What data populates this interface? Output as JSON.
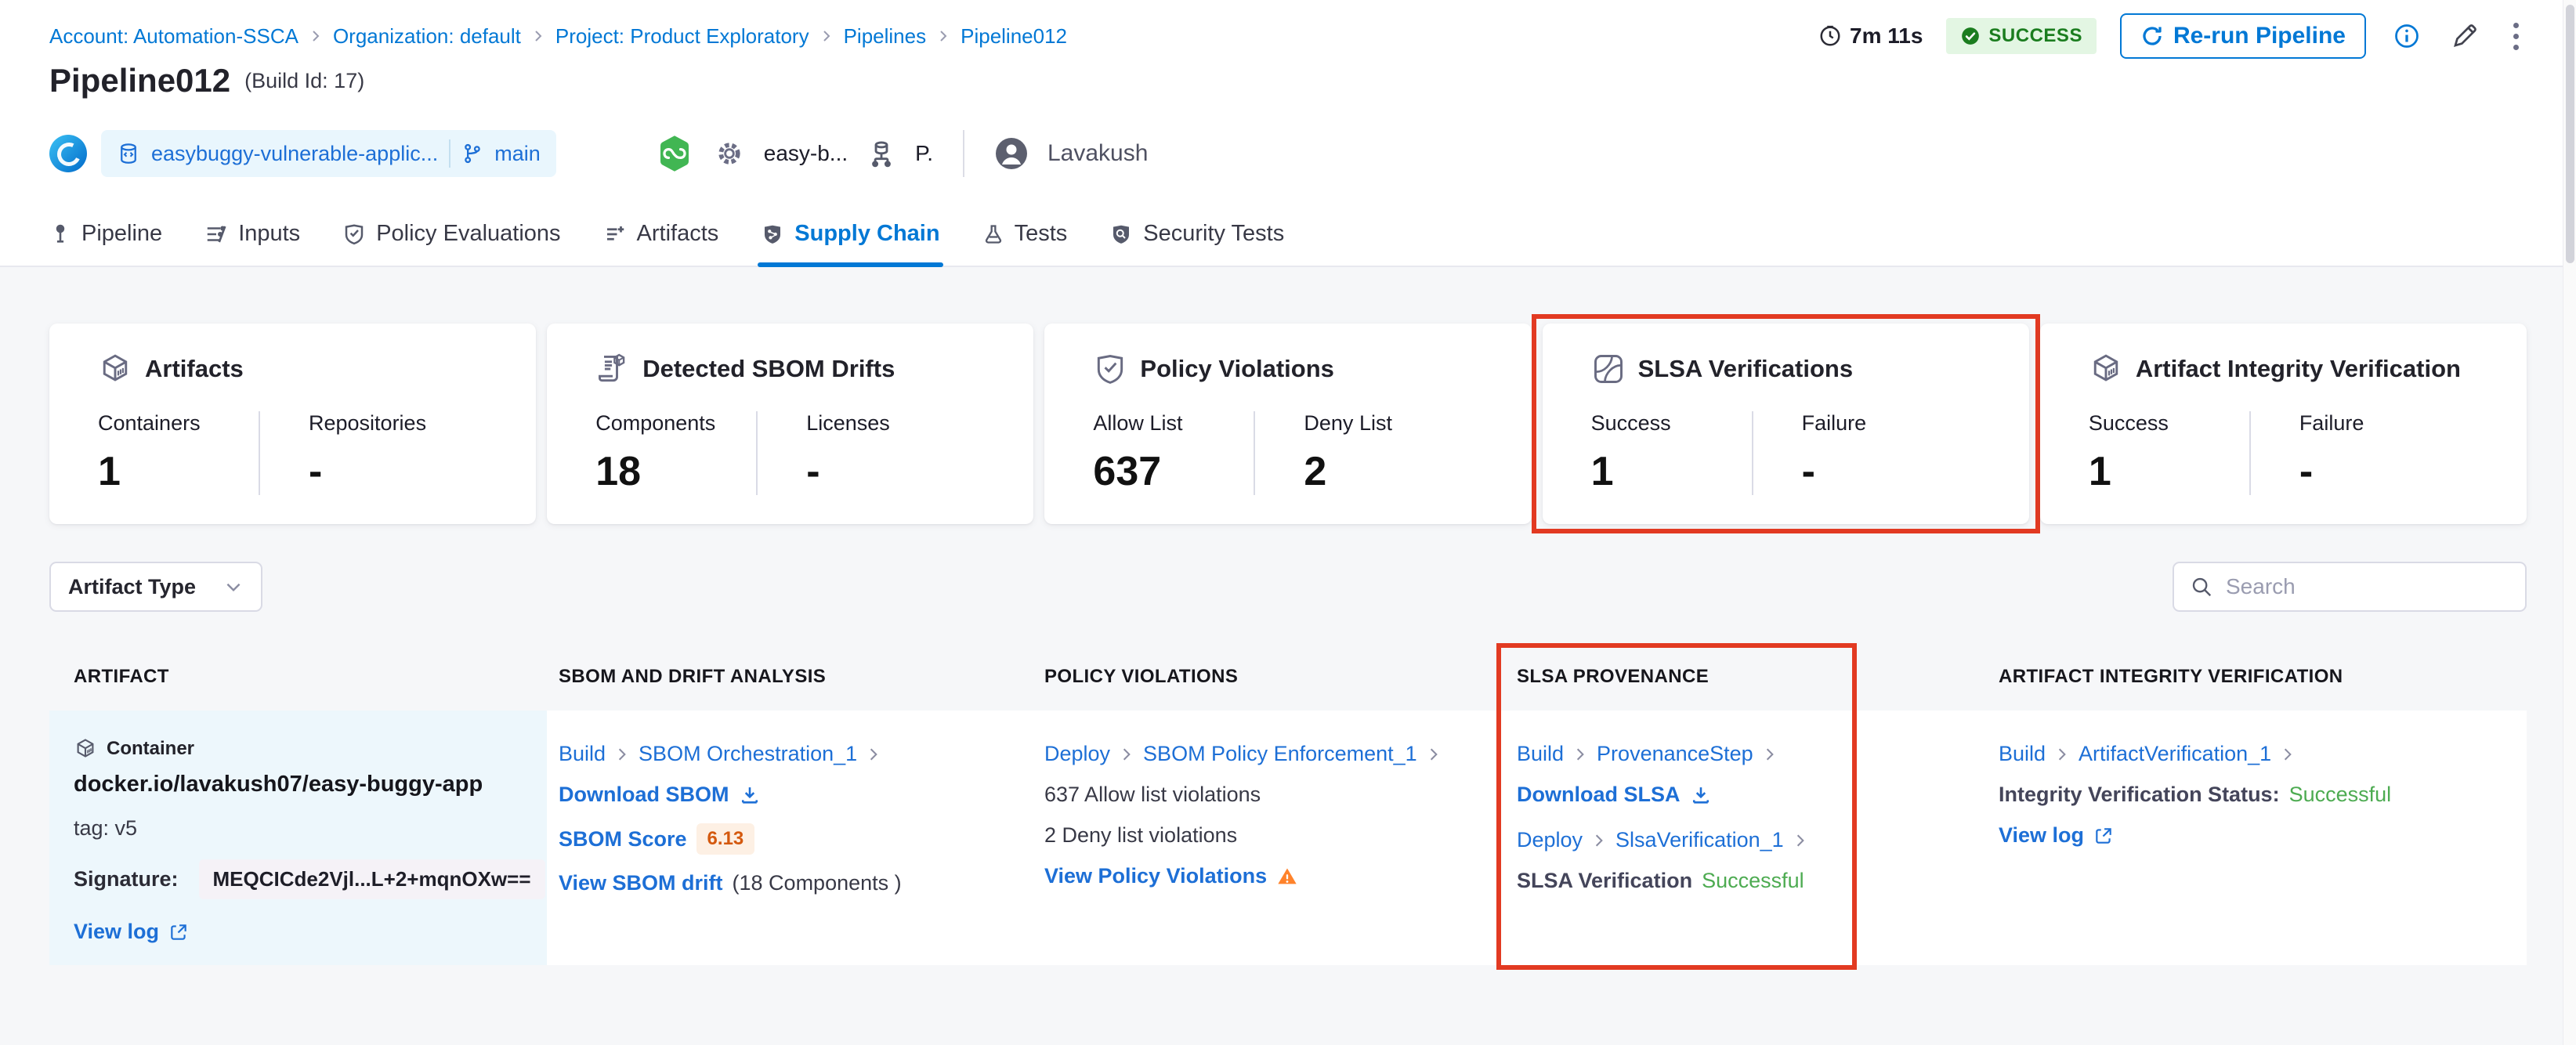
{
  "breadcrumb": {
    "items": [
      "Account: Automation-SSCA",
      "Organization: default",
      "Project: Product Exploratory",
      "Pipelines",
      "Pipeline012"
    ]
  },
  "header": {
    "duration": "7m 11s",
    "status": "SUCCESS",
    "rerun_label": "Re-run Pipeline",
    "title": "Pipeline012",
    "build_id": "(Build Id: 17)",
    "repo": "easybuggy-vulnerable-applic...",
    "branch": "main",
    "service": "easy-b...",
    "environment": "P.",
    "user": "Lavakush"
  },
  "tabs": [
    {
      "label": "Pipeline"
    },
    {
      "label": "Inputs"
    },
    {
      "label": "Policy Evaluations"
    },
    {
      "label": "Artifacts"
    },
    {
      "label": "Supply Chain",
      "active": true
    },
    {
      "label": "Tests"
    },
    {
      "label": "Security Tests"
    }
  ],
  "cards": [
    {
      "title": "Artifacts",
      "stats": [
        {
          "label": "Containers",
          "value": "1"
        },
        {
          "label": "Repositories",
          "value": "-"
        }
      ]
    },
    {
      "title": "Detected SBOM Drifts",
      "stats": [
        {
          "label": "Components",
          "value": "18"
        },
        {
          "label": "Licenses",
          "value": "-"
        }
      ]
    },
    {
      "title": "Policy Violations",
      "stats": [
        {
          "label": "Allow List",
          "value": "637"
        },
        {
          "label": "Deny List",
          "value": "2"
        }
      ]
    },
    {
      "title": "SLSA Verifications",
      "highlighted": true,
      "stats": [
        {
          "label": "Success",
          "value": "1"
        },
        {
          "label": "Failure",
          "value": "-"
        }
      ]
    },
    {
      "title": "Artifact Integrity Verification",
      "stats": [
        {
          "label": "Success",
          "value": "1"
        },
        {
          "label": "Failure",
          "value": "-"
        }
      ]
    }
  ],
  "filters": {
    "artifact_type_label": "Artifact Type",
    "search_placeholder": "Search"
  },
  "table": {
    "columns": [
      "Artifact",
      "SBOM and Drift Analysis",
      "Policy Violations",
      "SLSA Provenance",
      "Artifact Integrity Verification"
    ],
    "row": {
      "artifact": {
        "type_label": "Container",
        "image": "docker.io/lavakush07/easy-buggy-app",
        "tag": "tag: v5",
        "signature_label": "Signature:",
        "signature": "MEQCICde2Vjl...L+2+mqnOXw==",
        "view_log": "View log"
      },
      "sbom": {
        "stage": "Build",
        "step": "SBOM Orchestration_1",
        "download": "Download SBOM",
        "score_label": "SBOM Score",
        "score": "6.13",
        "drift_link": "View SBOM drift",
        "drift_suffix": "(18 Components )"
      },
      "policy": {
        "stage": "Deploy",
        "step": "SBOM Policy Enforcement_1",
        "allow": "637 Allow list violations",
        "deny": "2 Deny list violations",
        "view": "View Policy Violations"
      },
      "slsa": {
        "stage1": "Build",
        "step1": "ProvenanceStep",
        "download": "Download SLSA",
        "stage2": "Deploy",
        "step2": "SlsaVerification_1",
        "verification_label": "SLSA Verification",
        "verification_status": "Successful"
      },
      "integrity": {
        "stage": "Build",
        "step": "ArtifactVerification_1",
        "status_label": "Integrity Verification Status:",
        "status": "Successful",
        "view_log": "View log"
      }
    }
  },
  "colors": {
    "accent_blue": "#0278d5",
    "success_green": "#4dab51",
    "highlight_red": "#e23a22",
    "warning_orange": "#ff832b",
    "score_orange": "#d4590e"
  }
}
